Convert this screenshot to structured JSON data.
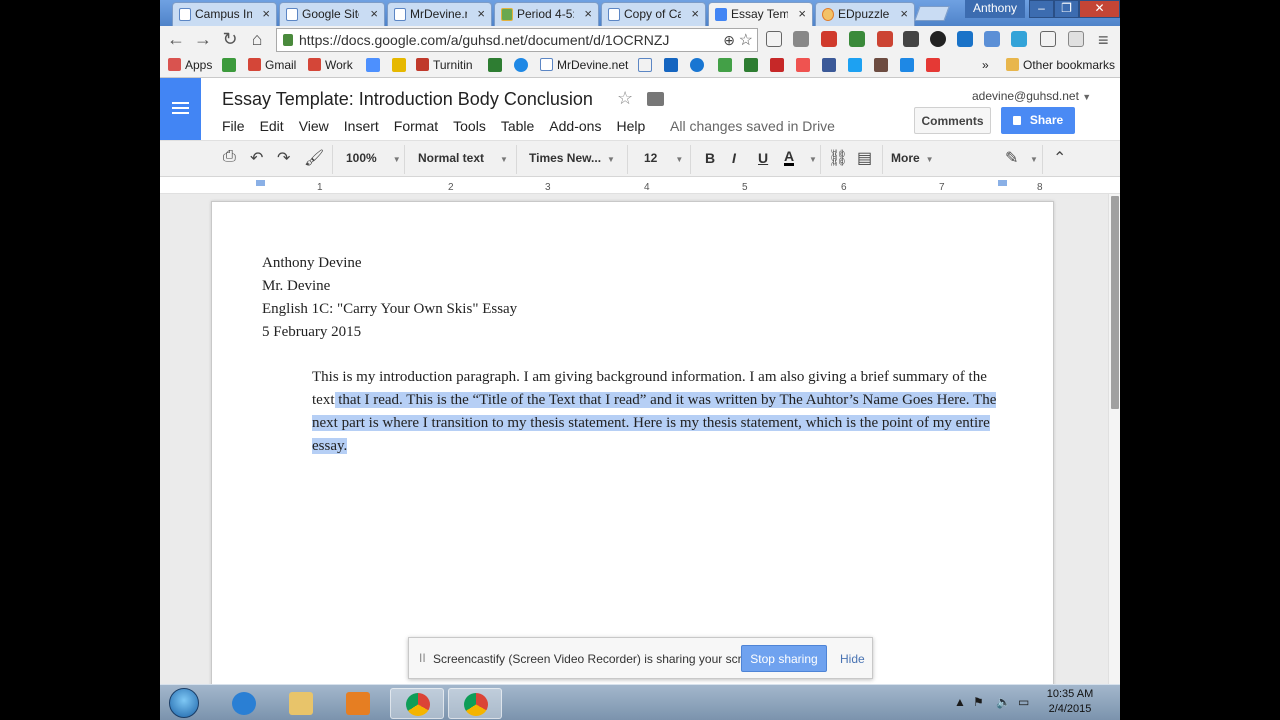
{
  "browser": {
    "tabs": [
      {
        "label": "Campus In"
      },
      {
        "label": "Google Site"
      },
      {
        "label": "MrDevine.r"
      },
      {
        "label": "Period 4-5:"
      },
      {
        "label": "Copy of Ca"
      },
      {
        "label": "Essay Temp"
      },
      {
        "label": "EDpuzzle"
      }
    ],
    "active_tab_index": 5,
    "user_name": "Anthony",
    "url": "https://docs.google.com/a/guhsd.net/document/d/1OCRNZJ",
    "bookmarks": [
      {
        "label": "Apps"
      },
      {
        "label": "Gmail"
      },
      {
        "label": "Work"
      },
      {
        "label": "Turnitin"
      },
      {
        "label": "MrDevine.net"
      }
    ],
    "other_bookmarks": "Other bookmarks",
    "overflow": "»"
  },
  "docs": {
    "title": "Essay Template: Introduction Body Conclusion",
    "menu": [
      "File",
      "Edit",
      "View",
      "Insert",
      "Format",
      "Tools",
      "Table",
      "Add-ons",
      "Help"
    ],
    "save_status": "All changes saved in Drive",
    "account": "adevine@guhsd.net",
    "comments_label": "Comments",
    "share_label": "Share"
  },
  "toolbar": {
    "zoom": "100%",
    "style": "Normal text",
    "font": "Times New...",
    "size": "12",
    "bold": "B",
    "italic": "I",
    "underline": "U",
    "text_color": "A",
    "more": "More"
  },
  "ruler": {
    "ticks": [
      "1",
      "2",
      "3",
      "4",
      "5",
      "6",
      "7",
      "8"
    ]
  },
  "document": {
    "heading_lines": [
      "Anthony Devine",
      "Mr. Devine",
      "English 1C: \"Carry Your Own Skis\" Essay",
      "5 February 2015"
    ],
    "para_part1": "This is my introduction paragraph. I am giving background information. I am also giving a brief summary of the ",
    "para_part2": "text",
    "para_highlight": " that I read. This is the “Title of the Text that I read” and it was written by The Auhtor’s Name Goes Here. The next part is where I transition to my thesis statement. Here is my thesis statement, which is the point of my entire essay."
  },
  "screencastify": {
    "pause_glyph": "II",
    "message": "Screencastify (Screen Video Recorder) is sharing your screen.",
    "stop_label": "Stop sharing",
    "hide_label": "Hide"
  },
  "taskbar": {
    "time": "10:35 AM",
    "date": "2/4/2015"
  },
  "colors": {
    "docs_blue": "#4285f4",
    "share_blue": "#4a8af4",
    "selection": "#b6cff5",
    "chrome_frame": "#5b8fd6"
  }
}
